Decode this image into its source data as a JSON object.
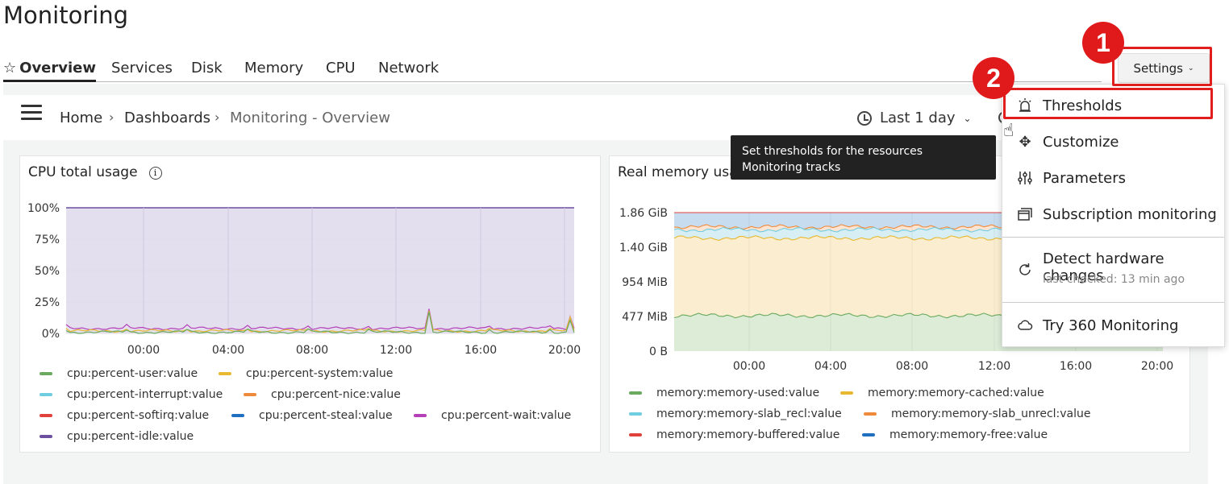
{
  "page_title": "Monitoring",
  "tabs": [
    "Overview",
    "Services",
    "Disk",
    "Memory",
    "CPU",
    "Network"
  ],
  "settings_label": "Settings",
  "breadcrumb": {
    "home": "Home",
    "dashboards": "Dashboards",
    "current": "Monitoring - Overview"
  },
  "time_range": "Last 1 day",
  "tooltip": {
    "line1": "Set thresholds for the resources",
    "line2": "Monitoring tracks"
  },
  "menu": {
    "items": [
      "Thresholds",
      "Customize",
      "Parameters",
      "Subscription monitoring",
      "Detect hardware changes",
      "Try 360 Monitoring"
    ],
    "last_checked": "last checked: 13 min ago"
  },
  "annotations": {
    "badge1": "1",
    "badge2": "2"
  },
  "colors": {
    "highlight": "#e01e1e",
    "tooltip_bg": "#222222"
  },
  "cpu_panel": {
    "title": "CPU total usage",
    "legend": [
      "cpu:percent-user:value",
      "cpu:percent-system:value",
      "cpu:percent-interrupt:value",
      "cpu:percent-nice:value",
      "cpu:percent-softirq:value",
      "cpu:percent-steal:value",
      "cpu:percent-wait:value",
      "cpu:percent-idle:value"
    ]
  },
  "mem_panel": {
    "title": "Real memory usage",
    "legend": [
      "memory:memory-used:value",
      "memory:memory-cached:value",
      "memory:memory-slab_recl:value",
      "memory:memory-slab_unrecl:value",
      "memory:memory-buffered:value",
      "memory:memory-free:value"
    ]
  },
  "chart_data": [
    {
      "type": "area",
      "title": "CPU total usage",
      "y_ticks": [
        "100%",
        "75%",
        "50%",
        "25%",
        "0%"
      ],
      "x_ticks": [
        "00:00",
        "04:00",
        "08:00",
        "12:00",
        "16:00",
        "20:00"
      ],
      "ylim": [
        0,
        100
      ],
      "series": [
        {
          "name": "cpu:percent-user:value",
          "color": "#6aaa5e",
          "approx_level": 1
        },
        {
          "name": "cpu:percent-system:value",
          "color": "#e8b830",
          "approx_level": 1
        },
        {
          "name": "cpu:percent-interrupt:value",
          "color": "#6fcde0",
          "approx_level": 0
        },
        {
          "name": "cpu:percent-nice:value",
          "color": "#ef8a3a",
          "approx_level": 0
        },
        {
          "name": "cpu:percent-softirq:value",
          "color": "#e0413a",
          "approx_level": 0
        },
        {
          "name": "cpu:percent-steal:value",
          "color": "#1f6fc0",
          "approx_level": 0
        },
        {
          "name": "cpu:percent-wait:value",
          "color": "#b43fb8",
          "approx_level": 3
        },
        {
          "name": "cpu:percent-idle:value",
          "color": "#6d4fa0",
          "approx_level": 100
        }
      ]
    },
    {
      "type": "area",
      "title": "Real memory usage",
      "y_ticks": [
        "1.86 GiB",
        "1.40 GiB",
        "954 MiB",
        "477 MiB",
        "0 B"
      ],
      "x_ticks": [
        "00:00",
        "04:00",
        "08:00",
        "12:00",
        "16:00",
        "20:00"
      ],
      "series": [
        {
          "name": "memory:memory-used:value",
          "color": "#6aaa5e"
        },
        {
          "name": "memory:memory-cached:value",
          "color": "#e8b830"
        },
        {
          "name": "memory:memory-slab_recl:value",
          "color": "#6fcde0"
        },
        {
          "name": "memory:memory-slab_unrecl:value",
          "color": "#ef8a3a"
        },
        {
          "name": "memory:memory-buffered:value",
          "color": "#e0413a"
        },
        {
          "name": "memory:memory-free:value",
          "color": "#1f6fc0"
        }
      ]
    }
  ]
}
